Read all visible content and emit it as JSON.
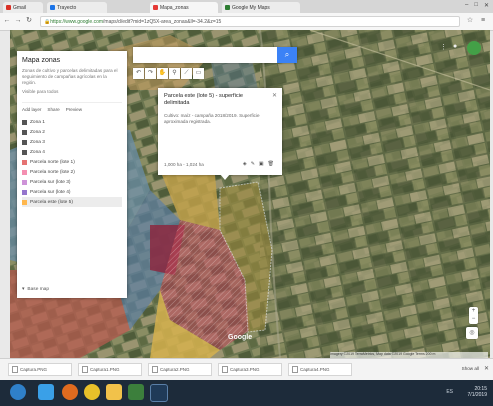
{
  "browser": {
    "tabs": [
      {
        "label": "Gmail",
        "color": "#d93025",
        "active": false
      },
      {
        "label": "Trayecto",
        "color": "#1a73e8",
        "active": false
      },
      {
        "label": "Mapa_zonas",
        "color": "#e53935",
        "active": true
      },
      {
        "label": "Google My Maps",
        "color": "#2e7d32",
        "active": false
      }
    ],
    "url_secure": "https://www.google.com",
    "url_rest": "/maps/d/edit?mid=1zQ5X-area_zonas&ll=-34.2&z=15",
    "window_controls": [
      "minimize-icon",
      "maximize-icon",
      "close-icon"
    ]
  },
  "map_panel": {
    "title": "Mapa zonas",
    "description": "Zonas de cultivo y parcelas delimitadas para el seguimiento de campañas agrícolas en la región.",
    "subtitle": "Visible para todos",
    "actions": [
      "Add layer",
      "Share",
      "Preview"
    ],
    "layers": [
      {
        "label": "Zona 1",
        "color": "#555555",
        "selected": false
      },
      {
        "label": "Zona 2",
        "color": "#555555",
        "selected": false
      },
      {
        "label": "Zona 3",
        "color": "#555555",
        "selected": false
      },
      {
        "label": "Zona 4",
        "color": "#555555",
        "selected": false
      },
      {
        "label": "Parcela norte (lote 1)",
        "color": "#e57373",
        "selected": false
      },
      {
        "label": "Parcela norte (lote 2)",
        "color": "#f48fb1",
        "selected": false
      },
      {
        "label": "Parcela sur (lote 3)",
        "color": "#ce93d8",
        "selected": false
      },
      {
        "label": "Parcela sur (lote 4)",
        "color": "#9575cd",
        "selected": false
      },
      {
        "label": "Parcela este (lote 5)",
        "color": "#ffb74d",
        "selected": true
      }
    ],
    "base_map": "Base map"
  },
  "search": {
    "placeholder": "",
    "button_icon": "search-icon"
  },
  "tools": [
    "undo-icon",
    "redo-icon",
    "hand-icon",
    "marker-icon",
    "line-icon",
    "ruler-icon"
  ],
  "popup": {
    "title": "Parcela este (lote 5) - superficie delimitada",
    "body": "Cultivo: maíz - campaña 2018/2019. Superficie aproximada registrada.",
    "footer": "1,000 ha - 1,024 ha",
    "icons": [
      "paint-icon",
      "edit-icon",
      "photo-icon",
      "delete-icon"
    ]
  },
  "attribution": "Imagery ©2019 TerraMetrics, Map data ©2019 Google  Terms  200 m",
  "downloads": [
    "Captura.PNG",
    "Captura1.PNG",
    "Captura2.PNG",
    "Captura3.PNG",
    "Captura4.PNG"
  ],
  "show_all": "Show all",
  "taskbar": {
    "icons": [
      {
        "name": "start-icon",
        "color": "#2f80c9"
      },
      {
        "name": "ie-icon",
        "color": "#3aa0e8"
      },
      {
        "name": "firefox-icon",
        "color": "#e06b1f"
      },
      {
        "name": "chrome-icon",
        "color": "#e8c12a"
      },
      {
        "name": "folder-icon",
        "color": "#f1c24a"
      },
      {
        "name": "app-icon",
        "color": "#3c7f3c"
      }
    ],
    "tray": "ES",
    "time": "20:15",
    "date": "7/1/2019"
  }
}
